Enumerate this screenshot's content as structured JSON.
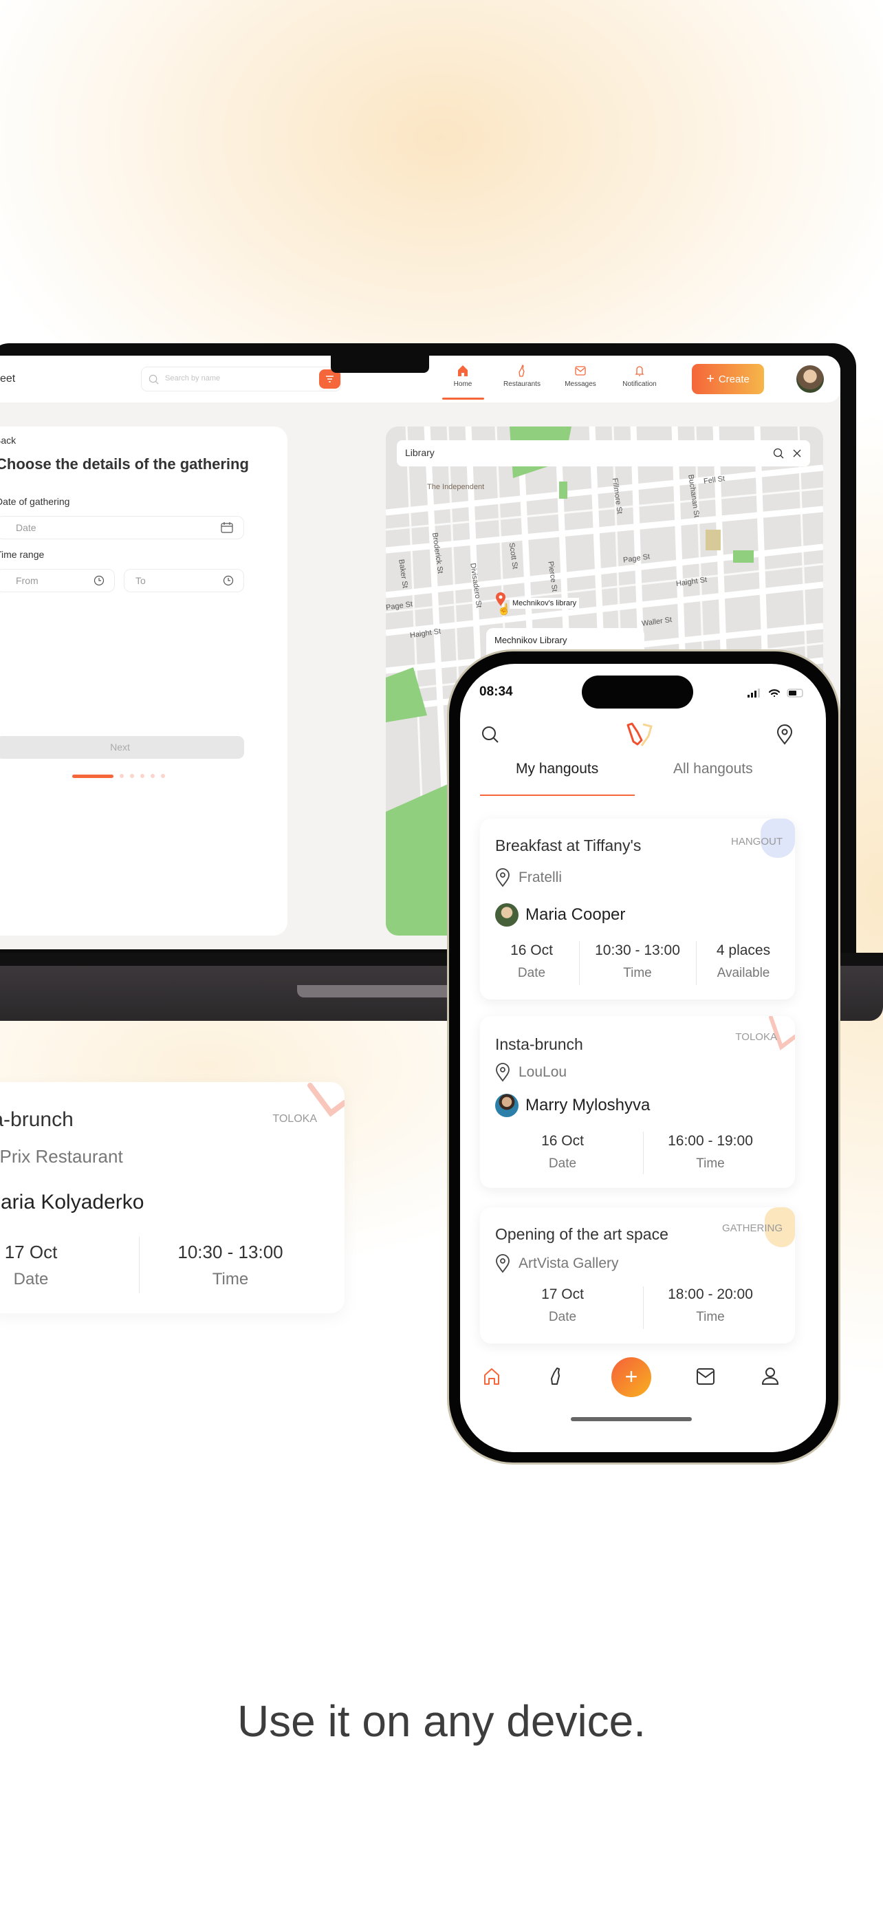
{
  "laptop": {
    "header": {
      "brand_partial": "eet",
      "search_placeholder": "Search by name",
      "nav": [
        {
          "label": "Home",
          "icon": "home-icon",
          "active": true
        },
        {
          "label": "Restaurants",
          "icon": "bottle-icon"
        },
        {
          "label": "Messages",
          "icon": "mail-icon"
        },
        {
          "label": "Notification",
          "icon": "bell-icon"
        }
      ],
      "create_label": "Create"
    },
    "form": {
      "back_label": "Back",
      "title": "Choose the details of the gathering",
      "date_label": "Date of gathering",
      "date_placeholder": "Date",
      "time_label": "Time range",
      "from_placeholder": "From",
      "to_placeholder": "To",
      "next_label": "Next",
      "steps_total": 6,
      "step_current": 1
    },
    "map": {
      "search_value": "Library",
      "labels": {
        "independent": "The Independent",
        "fell": "Fell St",
        "fillmore": "Fillmore St",
        "buchanan": "Buchanan St",
        "broderick": "Broderick St",
        "baker": "Baker St",
        "divisadero": "Divisadero St",
        "scott": "Scott St",
        "pierce": "Pierce St",
        "page_r": "Page St",
        "haight_r": "Haight St",
        "page_l": "Page St",
        "haight_l": "Haight St",
        "waller": "Waller St"
      },
      "marker_label": "Mechnikov's library",
      "result_title": "Mechnikov Library"
    }
  },
  "left_card": {
    "title": "Insta-brunch",
    "tag": "TOLOKA",
    "location": "Grand Prix Restaurant",
    "host": "Maria Kolyaderko",
    "date": "17 Oct",
    "date_label": "Date",
    "time": "10:30 - 13:00",
    "time_label": "Time"
  },
  "phone": {
    "status_time": "08:34",
    "tabs": [
      {
        "label": "My hangouts",
        "active": true
      },
      {
        "label": "All hangouts"
      }
    ],
    "cards": [
      {
        "title": "Breakfast at Tiffany's",
        "tag": "HANGOUT",
        "location": "Fratelli",
        "host": "Maria Cooper",
        "date": "16 Oct",
        "date_label": "Date",
        "time": "10:30 - 13:00",
        "time_label": "Time",
        "places": "4 places",
        "places_label": "Available"
      },
      {
        "title": "Insta-brunch",
        "tag": "TOLOKA",
        "location": "LouLou",
        "host": "Marry Myloshyva",
        "date": "16 Oct",
        "date_label": "Date",
        "time": "16:00 - 19:00",
        "time_label": "Time"
      },
      {
        "title": "Opening of the art space",
        "tag": "GATHERING",
        "location": "ArtVista Gallery",
        "date": "17 Oct",
        "date_label": "Date",
        "time": "18:00 - 20:00",
        "time_label": "Time"
      }
    ],
    "bottom_nav": [
      "home-icon",
      "bottle-icon",
      "plus-icon",
      "mail-icon",
      "user-icon"
    ]
  },
  "caption": "Use it on any device.",
  "colors": {
    "accent": "#f5663a",
    "accent_gradient_end": "#f6b64a",
    "text": "#333333"
  }
}
